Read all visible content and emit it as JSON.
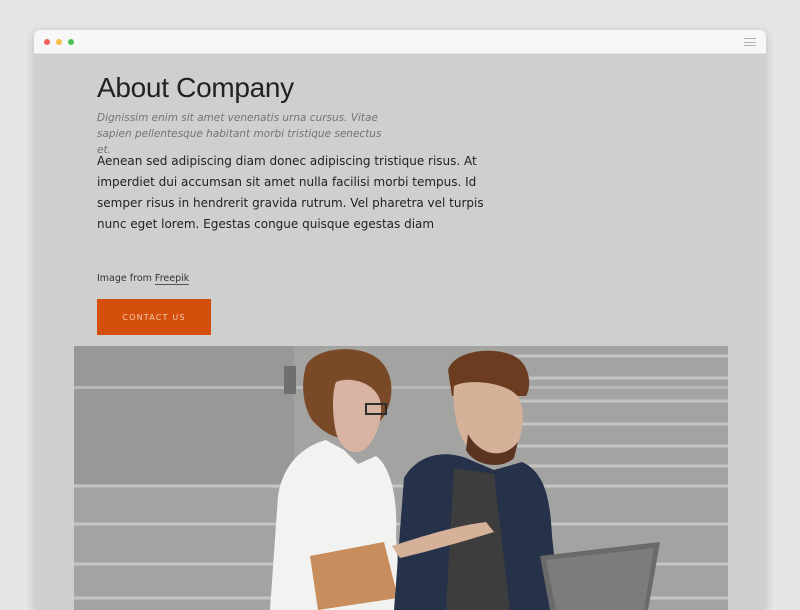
{
  "window": {
    "controls": {
      "close": "#f06257",
      "minimize": "#f6be4f",
      "zoom": "#4bc355"
    },
    "menu_icon": "hamburger-icon"
  },
  "about": {
    "title": "About Company",
    "subtitle": "Dignissim enim sit amet venenatis urna cursus. Vitae sapien pellentesque habitant morbi tristique senectus et.",
    "body": "Aenean sed adipiscing diam donec adipiscing tristique risus. At imperdiet dui accumsan sit amet nulla facilisi morbi tempus. Id semper risus in hendrerit gravida rutrum. Vel pharetra vel turpis nunc eget lorem. Egestas congue quisque egestas diam",
    "credit_prefix": "Image from",
    "credit_link": "Freepik",
    "cta_label": "CONTACT US",
    "accent": "#d44f0c"
  },
  "photo": {
    "subject": "two-people-on-stairs-laptop-photo"
  }
}
